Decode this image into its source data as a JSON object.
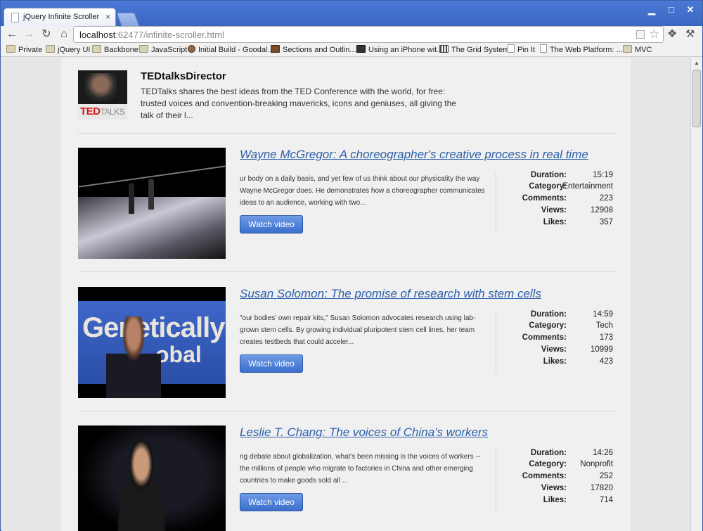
{
  "browser": {
    "tab_title": "jQuery Infinite Scroller",
    "tab_close": "×",
    "url_host": "localhost",
    "url_rest": ":62477/infinite-scroller.html",
    "bookmarks": [
      {
        "label": "Private",
        "icon": "folder-icon"
      },
      {
        "label": "jQuery UI",
        "icon": "folder-icon"
      },
      {
        "label": "Backbone",
        "icon": "folder-icon"
      },
      {
        "label": "JavaScript",
        "icon": "folder-icon"
      },
      {
        "label": "Initial Build - Goodal...",
        "icon": "site-icon"
      },
      {
        "label": "Sections and Outlin...",
        "icon": "site-icon"
      },
      {
        "label": "Using an iPhone wit...",
        "icon": "site-icon"
      },
      {
        "label": "The Grid System",
        "icon": "grid-icon"
      },
      {
        "label": "Pin It",
        "icon": "page-icon"
      },
      {
        "label": "The Web Platform: ...",
        "icon": "site-icon"
      },
      {
        "label": "MVC",
        "icon": "folder-icon"
      }
    ]
  },
  "channel": {
    "name": "TEDtalksDirector",
    "description": "TEDTalks shares the best ideas from the TED Conference with the world, for free: trusted voices and convention-breaking mavericks, icons and geniuses, all giving the talk of their l...",
    "logo_ted": "TED",
    "logo_talks": "TALKS"
  },
  "stat_labels": {
    "duration": "Duration:",
    "category": "Category:",
    "comments": "Comments:",
    "views": "Views:",
    "likes": "Likes:"
  },
  "videos": [
    {
      "title": "Wayne McGregor: A choreographer's creative process in real time",
      "description": "ur body on a daily basis, and yet few of us think about our physicality the way Wayne McGregor does. He demonstrates how a choreographer communicates ideas to an audience, working with two...",
      "button": "Watch video",
      "duration": "15:19",
      "category": "Entertainment",
      "comments": "223",
      "views": "12908",
      "likes": "357"
    },
    {
      "title": "Susan Solomon: The promise of research with stem cells",
      "description": "\"our bodies' own repair kits,\" Susan Solomon advocates research using lab-grown stem cells. By growing individual pluripotent stem cell lines, her team creates testbeds that could acceler...",
      "button": "Watch video",
      "duration": "14:59",
      "category": "Tech",
      "comments": "173",
      "views": "10999",
      "likes": "423"
    },
    {
      "title": "Leslie T. Chang: The voices of China's workers",
      "description": "ng debate about globalization, what's been missing is the voices of workers -- the millions of people who migrate to factories in China and other emerging countries to make goods sold all ...",
      "button": "Watch video",
      "duration": "14:26",
      "category": "Nonprofit",
      "comments": "252",
      "views": "17820",
      "likes": "714"
    }
  ],
  "thumb2_text": [
    "Genetically",
    "obal"
  ]
}
